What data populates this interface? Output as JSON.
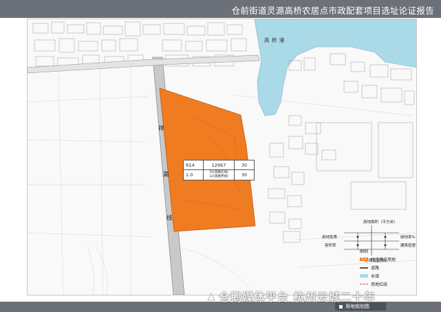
{
  "header": {
    "title": "仓前街道灵源高桥农居点市政配套项目选址论证报告"
  },
  "map": {
    "water_label": "高 桥 港",
    "road_chars": [
      "祥",
      "高",
      "线"
    ],
    "parcel_table": {
      "r1c1": "R14",
      "r1c2": "12967",
      "r1c3": "30",
      "r2c1": "1.0",
      "r2c2_top": "35(道路红线)",
      "r2c2_bottom": "12(道路界线)",
      "r2c3": "30"
    },
    "indicator_diagram": {
      "top": "用地面积（平方米）",
      "left_top": "用地性质",
      "left_bottom": "容积率",
      "right_top": "绿地率%",
      "right_bottom": "建筑密度%",
      "bottom": "建筑高度(米)"
    },
    "legend": {
      "title": "图例",
      "items": [
        {
          "code": "R14",
          "label": "村庄建设用地",
          "color": "#f07c21"
        },
        {
          "label": "道路",
          "color": "#555555"
        },
        {
          "label": "水域",
          "color": "#a8d8e6"
        },
        {
          "label": "用地红线",
          "color": "#d94040"
        }
      ]
    },
    "colors": {
      "parcel": "#f07c21",
      "water": "#aad9e8",
      "road": "#c9c9c9"
    }
  },
  "footer": {
    "tag": "用地规划图"
  },
  "watermark": {
    "text": "仓鹅媒体平台 杭州云城二十年"
  }
}
